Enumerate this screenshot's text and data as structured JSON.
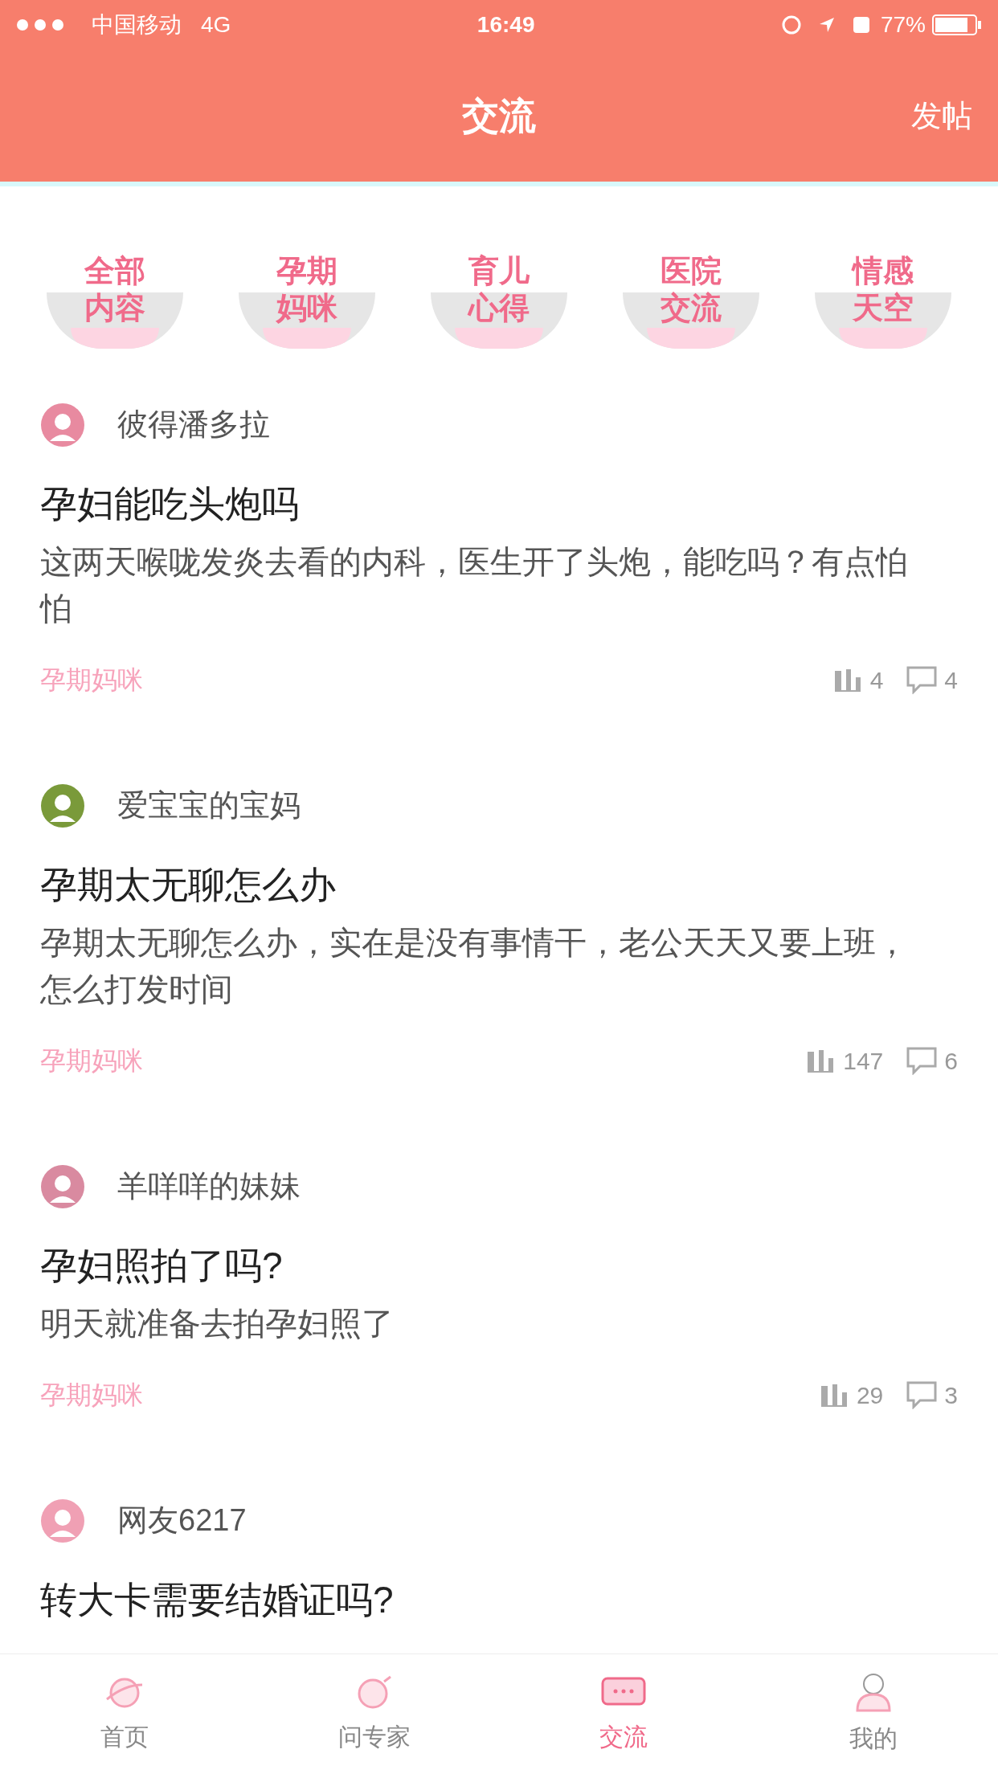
{
  "status_bar": {
    "carrier": "中国移动",
    "network": "4G",
    "time": "16:49",
    "battery": "77%"
  },
  "header": {
    "title": "交流",
    "action": "发帖"
  },
  "categories": [
    {
      "label": "全部内容"
    },
    {
      "label": "孕期妈咪"
    },
    {
      "label": "育儿心得"
    },
    {
      "label": "医院交流"
    },
    {
      "label": "情感天空"
    }
  ],
  "posts": [
    {
      "author": "彼得潘多拉",
      "color": "#e88aa0",
      "title": "孕妇能吃头炮吗",
      "body": "这两天喉咙发炎去看的内科，医生开了头炮，能吃吗？有点怕怕",
      "tag": "孕期妈咪",
      "views": "4",
      "comments": "4"
    },
    {
      "author": "爱宝宝的宝妈",
      "color": "#7a9a3a",
      "title": "孕期太无聊怎么办",
      "body": "孕期太无聊怎么办，实在是没有事情干，老公天天又要上班，怎么打发时间",
      "tag": "孕期妈咪",
      "views": "147",
      "comments": "6"
    },
    {
      "author": "羊咩咩的妹妹",
      "color": "#d98aa0",
      "title": "孕妇照拍了吗?",
      "body": "明天就准备去拍孕妇照了",
      "tag": "孕期妈咪",
      "views": "29",
      "comments": "3"
    },
    {
      "author": "网友6217",
      "color": "#f0a0b4",
      "title": "转大卡需要结婚证吗?"
    }
  ],
  "tab_bar": [
    {
      "label": "首页",
      "kind": "planet",
      "selected": false
    },
    {
      "label": "问专家",
      "kind": "expert",
      "selected": false
    },
    {
      "label": "交流",
      "kind": "chat",
      "selected": true
    },
    {
      "label": "我的",
      "kind": "person",
      "selected": false
    }
  ]
}
